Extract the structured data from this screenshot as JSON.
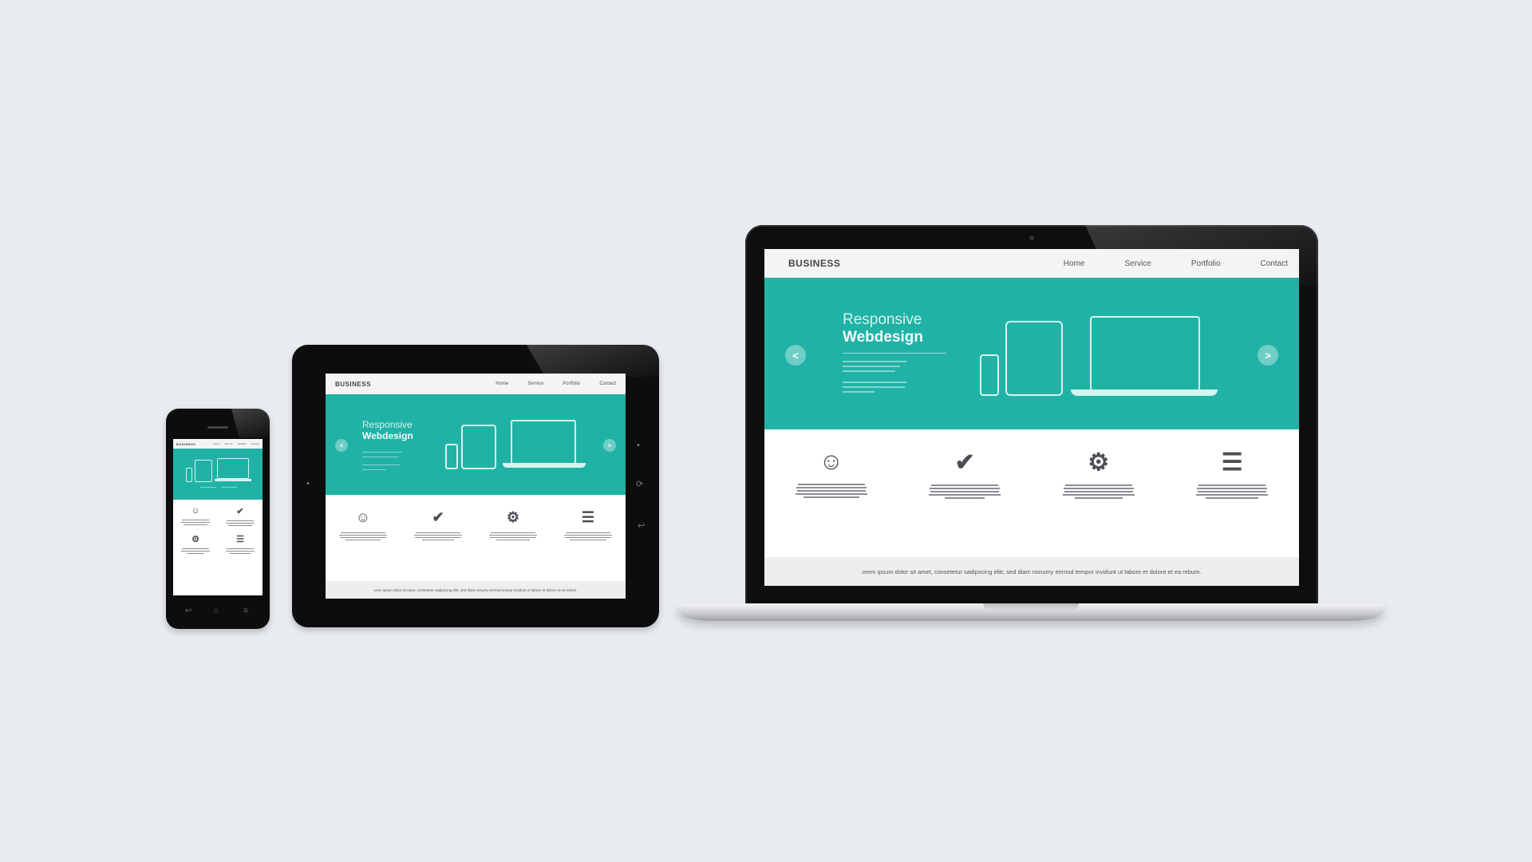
{
  "site": {
    "brand": "BUSINESS",
    "menu": [
      "Home",
      "Service",
      "Portfolio",
      "Contact"
    ],
    "hero": {
      "title_line1": "Responsive",
      "title_line2": "Webdesign",
      "prev_arrow": "<",
      "next_arrow": ">"
    },
    "features": [
      {
        "icon": "user-icon",
        "glyph": "☺"
      },
      {
        "icon": "check-icon",
        "glyph": "✔"
      },
      {
        "icon": "gear-icon",
        "glyph": "⚙"
      },
      {
        "icon": "list-icon",
        "glyph": "☰"
      }
    ],
    "footer_text": "orem ipsum dolor sit amet, consetetur sadipscing elitr, sed diam nonumy eirmod tempor invidunt ut labore et dolore et ea rebum."
  },
  "colors": {
    "background": "#e8ebef",
    "accent": "#21b2a6",
    "device": "#0d0d0e"
  }
}
